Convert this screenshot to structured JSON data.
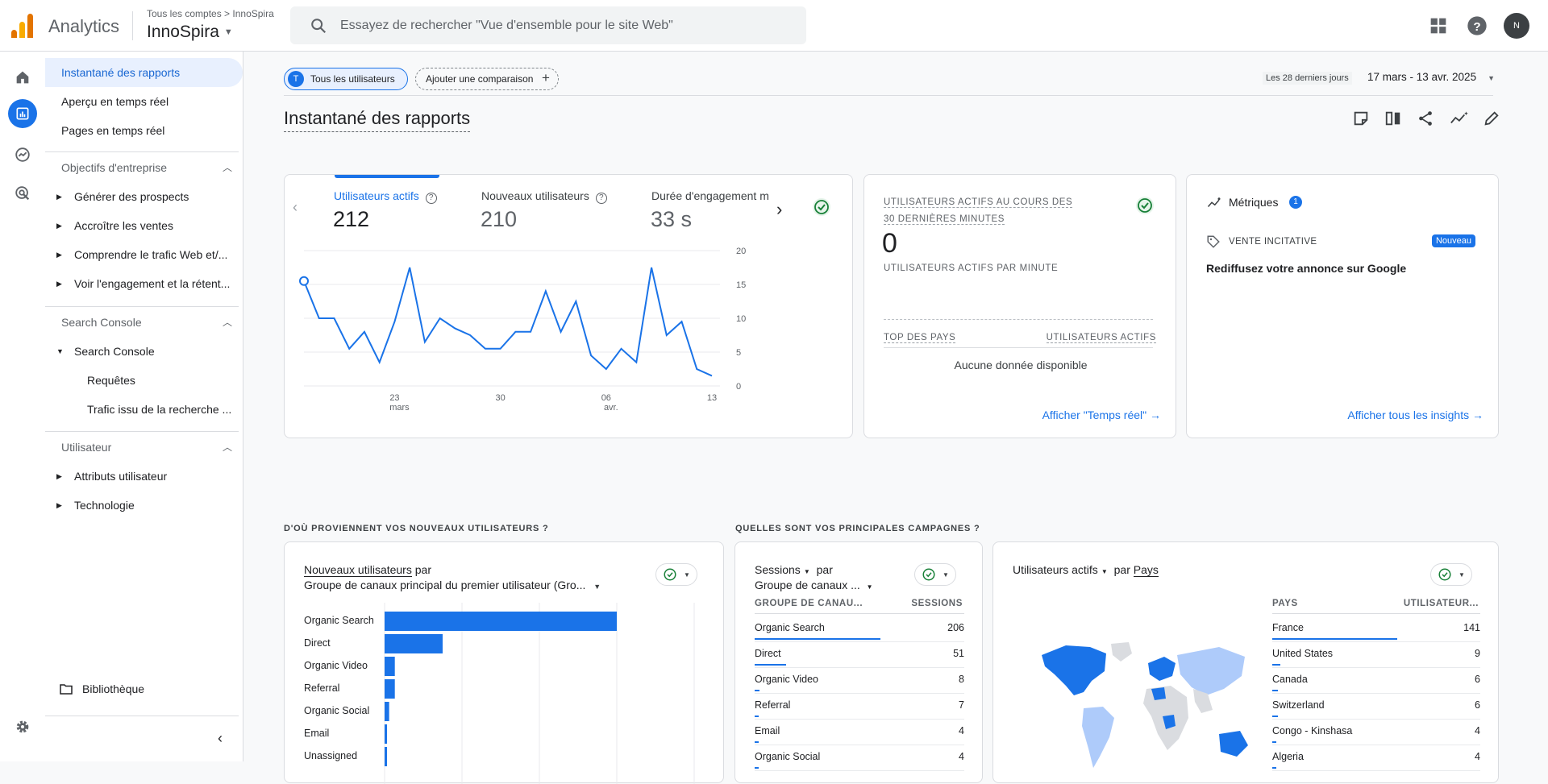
{
  "header": {
    "app_name": "Analytics",
    "breadcrumb": "Tous les comptes > InnoSpira",
    "property": "InnoSpira",
    "search_placeholder": "Essayez de rechercher \"Vue d'ensemble pour le site Web\"",
    "avatar_text": "N",
    "icons": [
      "apps-grid-icon",
      "help-icon"
    ]
  },
  "nav": {
    "items_top": [
      "Instantané des rapports",
      "Aperçu en temps réel",
      "Pages en temps réel"
    ],
    "section_business": "Objectifs d'entreprise",
    "business_items": [
      "Générer des prospects",
      "Accroître les ventes",
      "Comprendre le trafic Web et/...",
      "Voir l'engagement et la rétent..."
    ],
    "section_search_console": "Search Console",
    "search_console_group": "Search Console",
    "search_console_items": [
      "Requêtes",
      "Trafic issu de la recherche ..."
    ],
    "section_user": "Utilisateur",
    "user_items": [
      "Attributs utilisateur",
      "Technologie"
    ],
    "library": "Bibliothèque"
  },
  "toolbar": {
    "segment_badge": "T",
    "segment": "Tous les utilisateurs",
    "add_comparison": "Ajouter une comparaison",
    "date_prefix": "Les 28 derniers jours",
    "date_range": "17 mars - 13 avr. 2025"
  },
  "page_title": "Instantané des rapports",
  "metrics_card": {
    "tabs": [
      {
        "label": "Utilisateurs actifs",
        "value": "212"
      },
      {
        "label": "Nouveaux utilisateurs",
        "value": "210"
      },
      {
        "label": "Durée d'engagement m",
        "value": "33 s"
      }
    ]
  },
  "chart_data": {
    "type": "line",
    "title": "",
    "xlabel": "",
    "ylabel": "",
    "x_tick_labels": [
      [
        "23",
        "mars"
      ],
      [
        "30",
        ""
      ],
      [
        "06",
        "avr."
      ],
      [
        "13",
        ""
      ]
    ],
    "y_tick_labels": [
      "20",
      "15",
      "10",
      "5",
      "0"
    ],
    "ylim": [
      0,
      20
    ],
    "x": [
      "17 mars",
      "18 mars",
      "19 mars",
      "20 mars",
      "21 mars",
      "22 mars",
      "23 mars",
      "24 mars",
      "25 mars",
      "26 mars",
      "27 mars",
      "28 mars",
      "29 mars",
      "30 mars",
      "31 mars",
      "1 avr.",
      "2 avr.",
      "3 avr.",
      "4 avr.",
      "5 avr.",
      "6 avr.",
      "7 avr.",
      "8 avr.",
      "9 avr.",
      "10 avr.",
      "11 avr.",
      "12 avr.",
      "13 avr."
    ],
    "series": [
      {
        "name": "Utilisateurs actifs",
        "values": [
          15.5,
          10,
          10,
          5.5,
          8,
          3.5,
          9.5,
          17.5,
          6.5,
          10,
          8.5,
          7.5,
          5.5,
          5.5,
          8,
          8,
          14,
          8,
          12.5,
          4.5,
          2.5,
          5.5,
          3.5,
          17.5,
          7.5,
          9.5,
          2.5,
          1.5
        ]
      }
    ],
    "grid": true,
    "legend": "none"
  },
  "realtime_card": {
    "title_line1": "UTILISATEURS ACTIFS AU COURS DES",
    "title_line2": "30 DERNIÈRES MINUTES",
    "value": "0",
    "per_minute": "UTILISATEURS ACTIFS PAR MINUTE",
    "col_country": "TOP DES PAYS",
    "col_users": "UTILISATEURS ACTIFS",
    "empty": "Aucune donnée disponible",
    "link": "Afficher \"Temps réel\""
  },
  "insights_card": {
    "title": "Métriques",
    "badge": "1",
    "tag": "VENTE INCITATIVE",
    "new_badge": "Nouveau",
    "message": "Rediffusez votre annonce sur Google",
    "link": "Afficher tous les insights"
  },
  "sections": {
    "new_users_title": "D'OÙ PROVIENNENT VOS NOUVEAUX UTILISATEURS ?",
    "campaigns_title": "QUELLES SONT VOS PRINCIPALES CAMPAGNES ?"
  },
  "new_users_card": {
    "metric": "Nouveaux utilisateurs",
    "by": "par",
    "dimension": "Groupe de canaux principal du premier utilisateur (Gro...",
    "chart_data": {
      "type": "bar",
      "orientation": "horizontal",
      "categories": [
        "Organic Search",
        "Direct",
        "Organic Video",
        "Referral",
        "Organic Social",
        "Email",
        "Unassigned"
      ],
      "values": [
        204,
        51,
        9,
        9,
        4,
        2,
        2
      ],
      "xlim": [
        0,
        272
      ]
    }
  },
  "campaigns_card": {
    "metric": "Sessions",
    "by": "par",
    "dimension": "Groupe de canaux ...",
    "col1": "GROUPE DE CANAU...",
    "col2": "SESSIONS",
    "rows": [
      {
        "name": "Organic Search",
        "value": "206",
        "fraction": 1.0
      },
      {
        "name": "Direct",
        "value": "51",
        "fraction": 0.25
      },
      {
        "name": "Organic Video",
        "value": "8",
        "fraction": 0.04
      },
      {
        "name": "Referral",
        "value": "7",
        "fraction": 0.035
      },
      {
        "name": "Email",
        "value": "4",
        "fraction": 0.02
      },
      {
        "name": "Organic Social",
        "value": "4",
        "fraction": 0.02
      }
    ]
  },
  "countries_card": {
    "metric": "Utilisateurs actifs",
    "by": "par",
    "dimension": "Pays",
    "col1": "PAYS",
    "col2": "UTILISATEUR...",
    "rows": [
      {
        "name": "France",
        "value": "141",
        "fraction": 1.0
      },
      {
        "name": "United States",
        "value": "9",
        "fraction": 0.064
      },
      {
        "name": "Canada",
        "value": "6",
        "fraction": 0.043
      },
      {
        "name": "Switzerland",
        "value": "6",
        "fraction": 0.043
      },
      {
        "name": "Congo - Kinshasa",
        "value": "4",
        "fraction": 0.028
      },
      {
        "name": "Algeria",
        "value": "4",
        "fraction": 0.028
      }
    ]
  },
  "colors": {
    "accent": "#1a73e8",
    "success": "#188038",
    "map_high": "#1a73e8",
    "map_low": "#aecbfa",
    "map_none": "#dadce0"
  }
}
